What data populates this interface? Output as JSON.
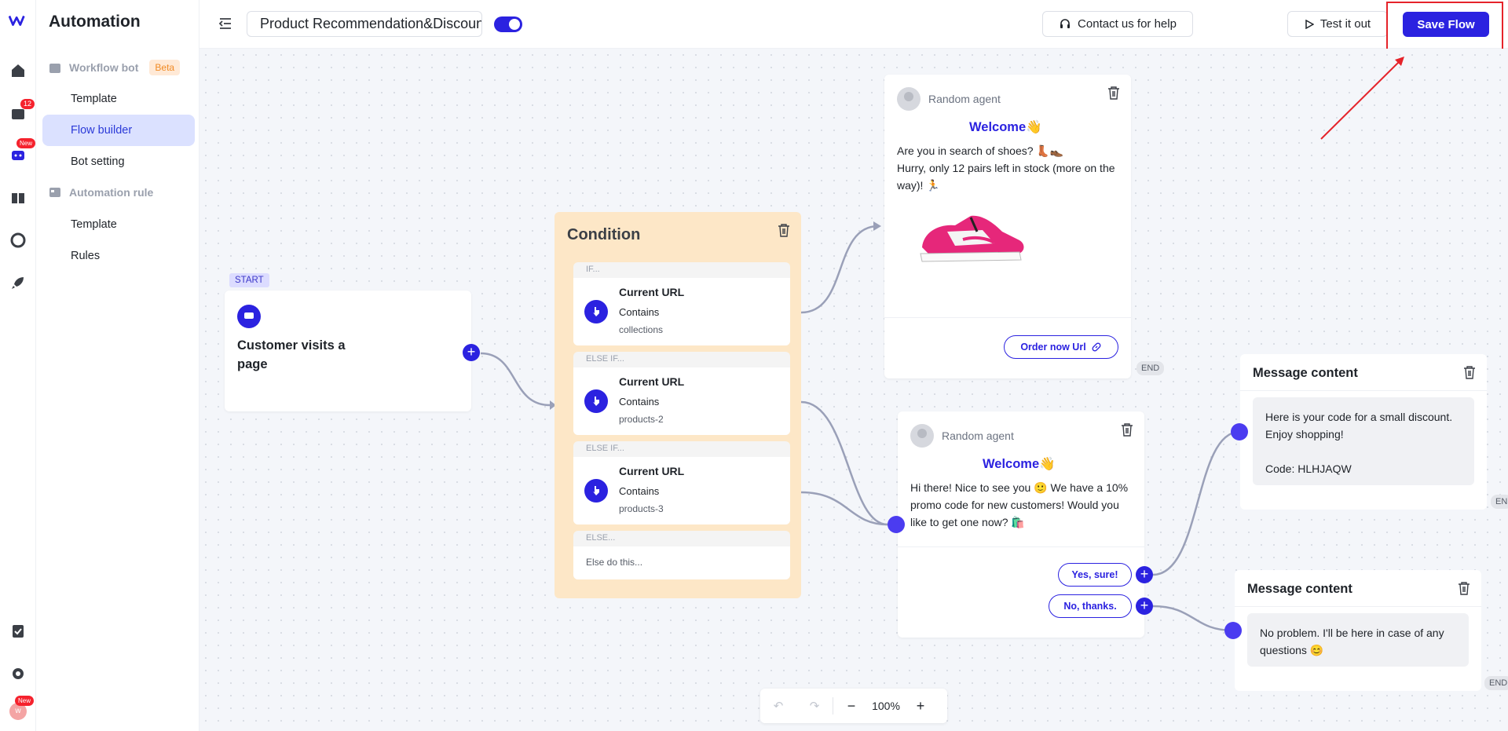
{
  "rail": {
    "inbox_count": "12",
    "new_badge": "New",
    "user_initial": "w",
    "user_new_badge": "New"
  },
  "sidebar": {
    "title": "Automation",
    "workflow_bot": {
      "label": "Workflow bot",
      "badge": "Beta"
    },
    "workflow_items": [
      {
        "label": "Template"
      },
      {
        "label": "Flow builder"
      },
      {
        "label": "Bot setting"
      }
    ],
    "automation_rule": {
      "label": "Automation rule"
    },
    "rule_items": [
      {
        "label": "Template"
      },
      {
        "label": "Rules"
      }
    ]
  },
  "header": {
    "flow_title": "Product Recommendation&Discount",
    "contact_label": "Contact us for help",
    "test_label": "Test it out",
    "save_label": "Save Flow"
  },
  "start_node": {
    "tag": "START",
    "text": "Customer visits a page"
  },
  "condition": {
    "title": "Condition",
    "rules": [
      {
        "label": "IF...",
        "field": "Current URL",
        "op": "Contains",
        "value": "collections"
      },
      {
        "label": "ELSE IF...",
        "field": "Current URL",
        "op": "Contains",
        "value": "products-2"
      },
      {
        "label": "ELSE IF...",
        "field": "Current URL",
        "op": "Contains",
        "value": "products-3"
      }
    ],
    "else": {
      "label": "ELSE...",
      "text": "Else do this..."
    }
  },
  "msg1": {
    "agent": "Random agent",
    "welcome": "Welcome👋",
    "line1": "Are you in search of shoes? 👢👞",
    "line2": "Hurry, only 12 pairs left in stock (more on the way)! 🏃",
    "button": "Order now Url",
    "end": "END"
  },
  "msg2": {
    "agent": "Random agent",
    "welcome": "Welcome👋",
    "text": "Hi there! Nice to see you 🙂 We have a 10% promo code for new customers! Would you like to get one now? 🛍️",
    "yes": "Yes, sure!",
    "no": "No, thanks."
  },
  "content1": {
    "title": "Message content",
    "line1": "Here is your code for a small discount. Enjoy shopping!",
    "line2": "Code:  HLHJAQW",
    "end": "EN"
  },
  "content2": {
    "title": "Message content",
    "text": "No problem. I'll be here in case of any questions 😊",
    "end": "END"
  },
  "zoom": {
    "level": "100%"
  },
  "colors": {
    "primary": "#2b22e0",
    "condition_bg": "#fde7c7",
    "highlight": "#e5232a"
  }
}
